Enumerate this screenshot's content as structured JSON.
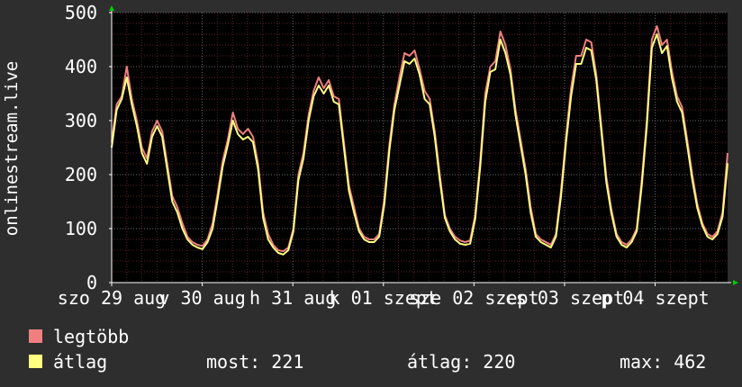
{
  "chart_data": {
    "type": "line",
    "ylabel": "onlinestream.live",
    "ylim": [
      0,
      500
    ],
    "y_ticks": [
      "0",
      "100",
      "200",
      "300",
      "400",
      "500"
    ],
    "x_tick_labels": [
      "szo 29 aug",
      "v 30 aug",
      "h 31 aug",
      "k 01 szept",
      "sze 02 szept",
      "cs 03 szept",
      "p 04 szept"
    ],
    "grid": true,
    "colors": {
      "background": "#2e2e2e",
      "plot_background": "#000000",
      "grid_minor": "#5a2020",
      "grid_major": "#6a6a6a",
      "legtobb": "#f08080",
      "atlag": "#ffff80",
      "axis": "#ffffff",
      "arrow": "#00cc00"
    },
    "series": [
      {
        "name": "legtöbb",
        "color": "#f08080",
        "values": [
          260,
          330,
          345,
          400,
          340,
          300,
          250,
          230,
          280,
          300,
          280,
          220,
          160,
          140,
          110,
          85,
          75,
          70,
          68,
          80,
          110,
          165,
          225,
          265,
          315,
          285,
          275,
          285,
          270,
          220,
          130,
          90,
          70,
          60,
          58,
          65,
          100,
          200,
          240,
          310,
          355,
          380,
          360,
          375,
          345,
          340,
          260,
          180,
          140,
          100,
          85,
          80,
          80,
          90,
          155,
          255,
          330,
          380,
          425,
          420,
          430,
          395,
          355,
          340,
          280,
          200,
          125,
          100,
          85,
          78,
          75,
          78,
          125,
          225,
          350,
          400,
          410,
          465,
          440,
          395,
          320,
          265,
          210,
          140,
          90,
          80,
          75,
          70,
          90,
          170,
          270,
          360,
          420,
          420,
          450,
          445,
          385,
          290,
          195,
          135,
          90,
          75,
          70,
          80,
          100,
          190,
          300,
          450,
          475,
          440,
          450,
          390,
          345,
          325,
          265,
          200,
          145,
          110,
          90,
          85,
          95,
          130,
          240
        ]
      },
      {
        "name": "átlag",
        "color": "#ffff80",
        "values": [
          250,
          320,
          340,
          380,
          330,
          290,
          240,
          220,
          270,
          290,
          270,
          210,
          150,
          130,
          100,
          80,
          70,
          65,
          62,
          75,
          100,
          155,
          215,
          255,
          300,
          275,
          265,
          270,
          260,
          210,
          120,
          80,
          65,
          55,
          52,
          60,
          95,
          190,
          230,
          300,
          345,
          365,
          350,
          365,
          335,
          330,
          250,
          170,
          130,
          95,
          80,
          75,
          75,
          85,
          145,
          245,
          320,
          365,
          410,
          405,
          415,
          385,
          340,
          330,
          270,
          190,
          120,
          95,
          80,
          72,
          70,
          72,
          118,
          215,
          335,
          390,
          395,
          450,
          425,
          385,
          310,
          255,
          200,
          130,
          85,
          75,
          70,
          65,
          85,
          160,
          260,
          345,
          405,
          405,
          435,
          430,
          375,
          280,
          185,
          128,
          85,
          70,
          65,
          75,
          95,
          180,
          290,
          435,
          460,
          425,
          438,
          378,
          335,
          315,
          255,
          190,
          138,
          105,
          85,
          80,
          90,
          122,
          221
        ]
      }
    ],
    "legend": {
      "items": [
        {
          "name": "legtöbb",
          "color": "#f08080"
        },
        {
          "name": "átlag",
          "color": "#ffff80"
        }
      ],
      "stats": {
        "most": "most: 221",
        "atlag": "átlag: 220",
        "max": "max: 462"
      }
    }
  }
}
